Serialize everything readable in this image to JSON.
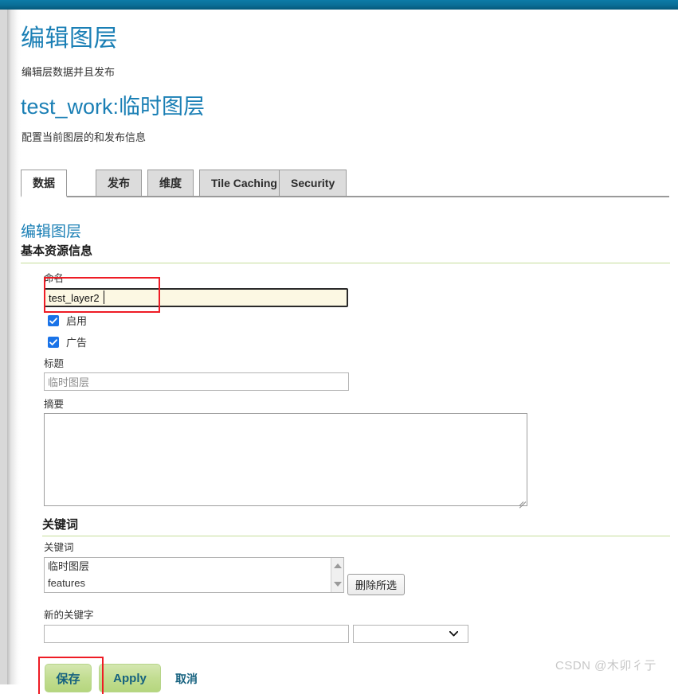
{
  "window": {
    "accent_teal": "#0a6e96",
    "link_blue": "#1a7fb5",
    "annotation_red": "#ee1c25",
    "button_green": "#c2dd91"
  },
  "header": {
    "page_title": "编辑图层",
    "page_subtitle": "编辑层数据并且发布",
    "resource_title": "test_work:临时图层",
    "resource_subtitle": "配置当前图层的和发布信息"
  },
  "tabs": [
    {
      "label": "数据",
      "active": true
    },
    {
      "label": "发布",
      "active": false
    },
    {
      "label": "维度",
      "active": false
    },
    {
      "label": "Tile Caching",
      "active": false
    },
    {
      "label": "Security",
      "active": false
    }
  ],
  "basic_section": {
    "link_heading": "编辑图层",
    "heading": "基本资源信息",
    "name_label": "命名",
    "name_value": "test_layer2",
    "checkboxes": [
      {
        "label": "启用",
        "checked": true
      },
      {
        "label": "广告",
        "checked": true
      }
    ],
    "title_label": "标题",
    "title_value": "临时图层",
    "abstract_label": "摘要",
    "abstract_value": ""
  },
  "keywords_section": {
    "heading": "关键词",
    "list_label": "关键词",
    "items": [
      "临时图层",
      "features"
    ],
    "remove_button": "删除所选",
    "new_keyword_label": "新的关键字",
    "new_keyword_value": "",
    "vocabulary_value": ""
  },
  "actions": {
    "save": "保存",
    "apply": "Apply",
    "cancel": "取消"
  },
  "watermark": "CSDN @木卯彳亍"
}
